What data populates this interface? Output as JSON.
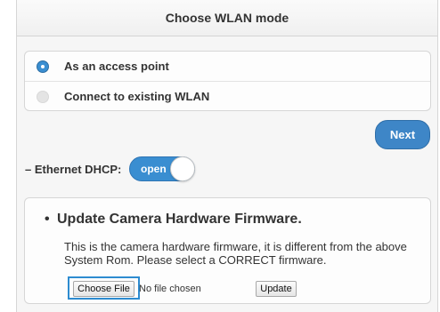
{
  "header": {
    "title": "Choose WLAN mode"
  },
  "wlan_modes": [
    {
      "label": "As an access point",
      "selected": true
    },
    {
      "label": "Connect to existing WLAN",
      "selected": false
    }
  ],
  "next_label": "Next",
  "ethernet": {
    "label": "– Ethernet DHCP:",
    "toggle_label": "open",
    "enabled": true
  },
  "firmware": {
    "bullet": "•",
    "title": "Update Camera Hardware Firmware.",
    "description": "This is the camera hardware firmware, it is different from the above System Rom. Please select a CORRECT firmware.",
    "choose_file_label": "Choose File",
    "file_status": "No file chosen",
    "update_label": "Update"
  },
  "colors": {
    "accent": "#3a8ed1",
    "highlight": "#2d8bd0"
  }
}
